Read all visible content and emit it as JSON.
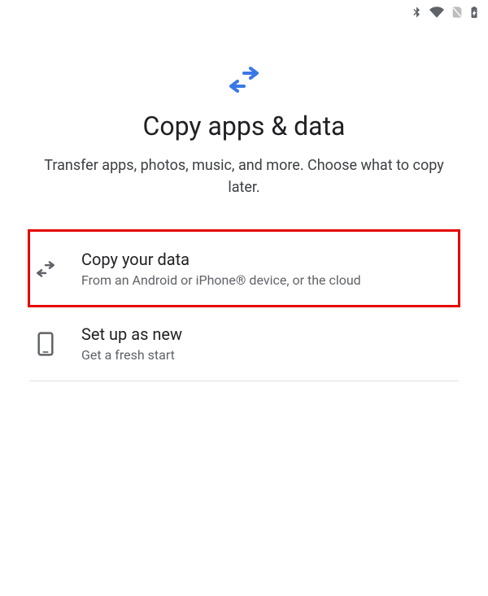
{
  "header": {
    "title": "Copy apps & data",
    "subtitle": "Transfer apps, photos, music, and more. Choose what to copy later."
  },
  "options": {
    "copy": {
      "title": "Copy your data",
      "subtitle": "From an Android or iPhone® device, or the cloud"
    },
    "new": {
      "title": "Set up as new",
      "subtitle": "Get a fresh start"
    }
  }
}
